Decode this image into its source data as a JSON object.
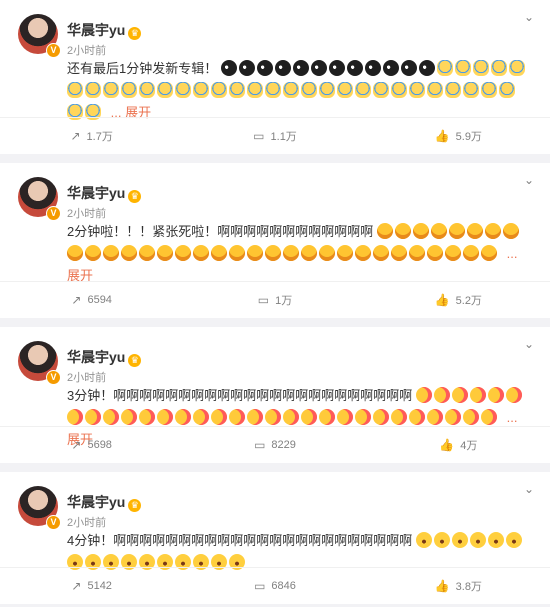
{
  "posts": [
    {
      "author": "华晨宇yu",
      "time": "2小时前",
      "text": "还有最后1分钟发新专辑！",
      "emoji_pattern": [
        "dark",
        "dark",
        "dark",
        "dark",
        "dark",
        "dark",
        "dark",
        "dark",
        "dark",
        "dark",
        "dark",
        "dark",
        "sweat",
        "sweat",
        "sweat",
        "sweat",
        "sweat",
        "sweat",
        "sweat",
        "sweat",
        "sweat",
        "sweat",
        "sweat",
        "sweat",
        "sweat",
        "sweat",
        "sweat",
        "sweat",
        "sweat",
        "sweat",
        "sweat",
        "sweat",
        "sweat",
        "sweat",
        "sweat",
        "sweat",
        "sweat",
        "sweat",
        "sweat",
        "sweat",
        "sweat",
        "sweat",
        "sweat",
        "sweat"
      ],
      "more": "... 展开",
      "repost": "1.7万",
      "comment": "1.1万",
      "like": "5.9万"
    },
    {
      "author": "华晨宇yu",
      "time": "2小时前",
      "text": "2分钟啦！！！紧张死啦！啊啊啊啊啊啊啊啊啊啊啊啊",
      "emoji_pattern": [
        "angry",
        "angry",
        "angry",
        "angry",
        "angry",
        "angry",
        "angry",
        "angry",
        "angry",
        "angry",
        "angry",
        "angry",
        "angry",
        "angry",
        "angry",
        "angry",
        "angry",
        "angry",
        "angry",
        "angry",
        "angry",
        "angry",
        "angry",
        "angry",
        "angry",
        "angry",
        "angry",
        "angry",
        "angry",
        "angry",
        "angry",
        "angry"
      ],
      "more": "... 展开",
      "repost": "6594",
      "comment": "1万",
      "like": "5.2万"
    },
    {
      "author": "华晨宇yu",
      "time": "2小时前",
      "text": "3分钟！啊啊啊啊啊啊啊啊啊啊啊啊啊啊啊啊啊啊啊啊啊啊啊",
      "emoji_pattern": [
        "kiss",
        "kiss",
        "kiss",
        "kiss",
        "kiss",
        "kiss",
        "kiss",
        "kiss",
        "kiss",
        "kiss",
        "kiss",
        "kiss",
        "kiss",
        "kiss",
        "kiss",
        "kiss",
        "kiss",
        "kiss",
        "kiss",
        "kiss",
        "kiss",
        "kiss",
        "kiss",
        "kiss",
        "kiss",
        "kiss",
        "kiss",
        "kiss",
        "kiss",
        "kiss"
      ],
      "more": "... 展开",
      "repost": "5698",
      "comment": "8229",
      "like": "4万"
    },
    {
      "author": "华晨宇yu",
      "time": "2小时前",
      "text": "4分钟！啊啊啊啊啊啊啊啊啊啊啊啊啊啊啊啊啊啊啊啊啊啊啊",
      "emoji_pattern": [
        "shock",
        "shock",
        "shock",
        "shock",
        "shock",
        "shock",
        "shock",
        "shock",
        "shock",
        "shock",
        "shock",
        "shock",
        "shock",
        "shock",
        "shock",
        "shock"
      ],
      "more": "",
      "repost": "5142",
      "comment": "6846",
      "like": "3.8万"
    }
  ],
  "icons": {
    "menu": "chevron-down-icon",
    "repost": "repost-icon",
    "comment": "comment-icon",
    "like": "like-icon"
  },
  "colors": {
    "link": "#eb7350",
    "muted": "#808080",
    "bg": "#f2f2f5"
  }
}
